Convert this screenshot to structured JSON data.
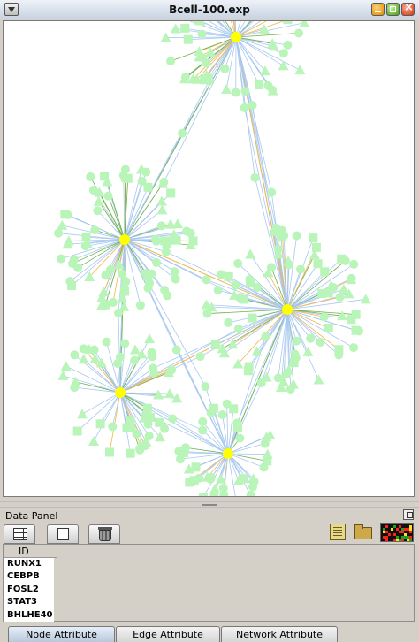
{
  "window": {
    "title": "Bcell-100.exp"
  },
  "graph": {
    "colors": {
      "node": "#b9f4b9",
      "hub": "#ffff00",
      "edge_blue": "#a8c8f0",
      "edge_green": "#6fb04a",
      "edge_orange": "#f2b64a"
    },
    "hubs": [
      "RUNX1",
      "CEBPB",
      "FOSL2",
      "STAT3",
      "BHLHE40"
    ]
  },
  "data_panel": {
    "title": "Data Panel",
    "column_header": "ID",
    "ids": [
      "RUNX1",
      "CEBPB",
      "FOSL2",
      "STAT3",
      "BHLHE40"
    ],
    "toolbar_icons": [
      "table-icon",
      "page-icon",
      "trash-icon",
      "attribute-icon",
      "folder-icon",
      "heatmap-icon"
    ]
  },
  "tabs": [
    {
      "label": "Node Attribute Browser",
      "active": true
    },
    {
      "label": "Edge Attribute Browser",
      "active": false
    },
    {
      "label": "Network Attribute Browser",
      "active": false
    }
  ]
}
